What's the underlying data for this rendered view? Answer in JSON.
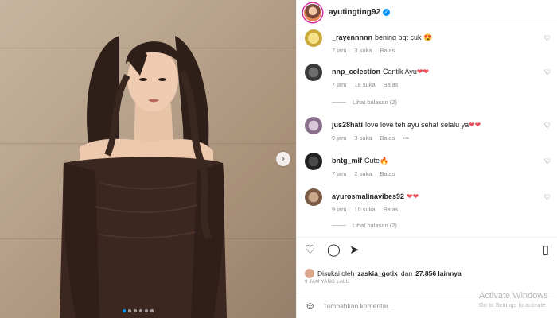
{
  "post": {
    "username": "ayutingting92",
    "verified_symbol": "✓"
  },
  "comments": [
    {
      "user": "_rayennnnn",
      "text": "bening bgt cuk 😍",
      "time": "7 jam",
      "likes": "3 suka",
      "reply": "Balas"
    },
    {
      "user": "nnp_colection",
      "text": "Cantik Ayu",
      "hearts": "❤❤",
      "time": "7 jam",
      "likes": "18 suka",
      "reply": "Balas",
      "view_replies": "Lihat balasan (2)"
    },
    {
      "user": "jus28hati",
      "text": "love love teh ayu sehat selalu ya",
      "hearts": "❤❤",
      "time": "9 jam",
      "likes": "3 suka",
      "reply": "Balas",
      "more": "•••"
    },
    {
      "user": "bntg_mlf",
      "text": "Cute🔥",
      "time": "7 jam",
      "likes": "2 suka",
      "reply": "Balas"
    },
    {
      "user": "ayurosmalinavibes92",
      "text": "",
      "hearts": "❤❤",
      "time": "9 jam",
      "likes": "10 suka",
      "reply": "Balas",
      "view_replies": "Lihat balasan (2)"
    }
  ],
  "likes_text": {
    "prefix": "Disukai oleh",
    "user": "zaskia_gotix",
    "middle": "dan",
    "count": "27.856 lainnya"
  },
  "timestamp": "9 JAM YANG LALU",
  "add_comment": {
    "placeholder": "Tambahkan komentar..."
  },
  "watermark": {
    "line1": "Activate Windows",
    "line2": "Go to Settings to activate"
  },
  "icons": {
    "heart_outline": "♡",
    "comment": "◯",
    "share": "➤",
    "bookmark": "▯",
    "emoji": "☺",
    "next": "›"
  },
  "colors": {
    "accent": "#0095f6",
    "heart": "#ed4956",
    "text": "#262626",
    "muted": "#8e8e8e"
  }
}
